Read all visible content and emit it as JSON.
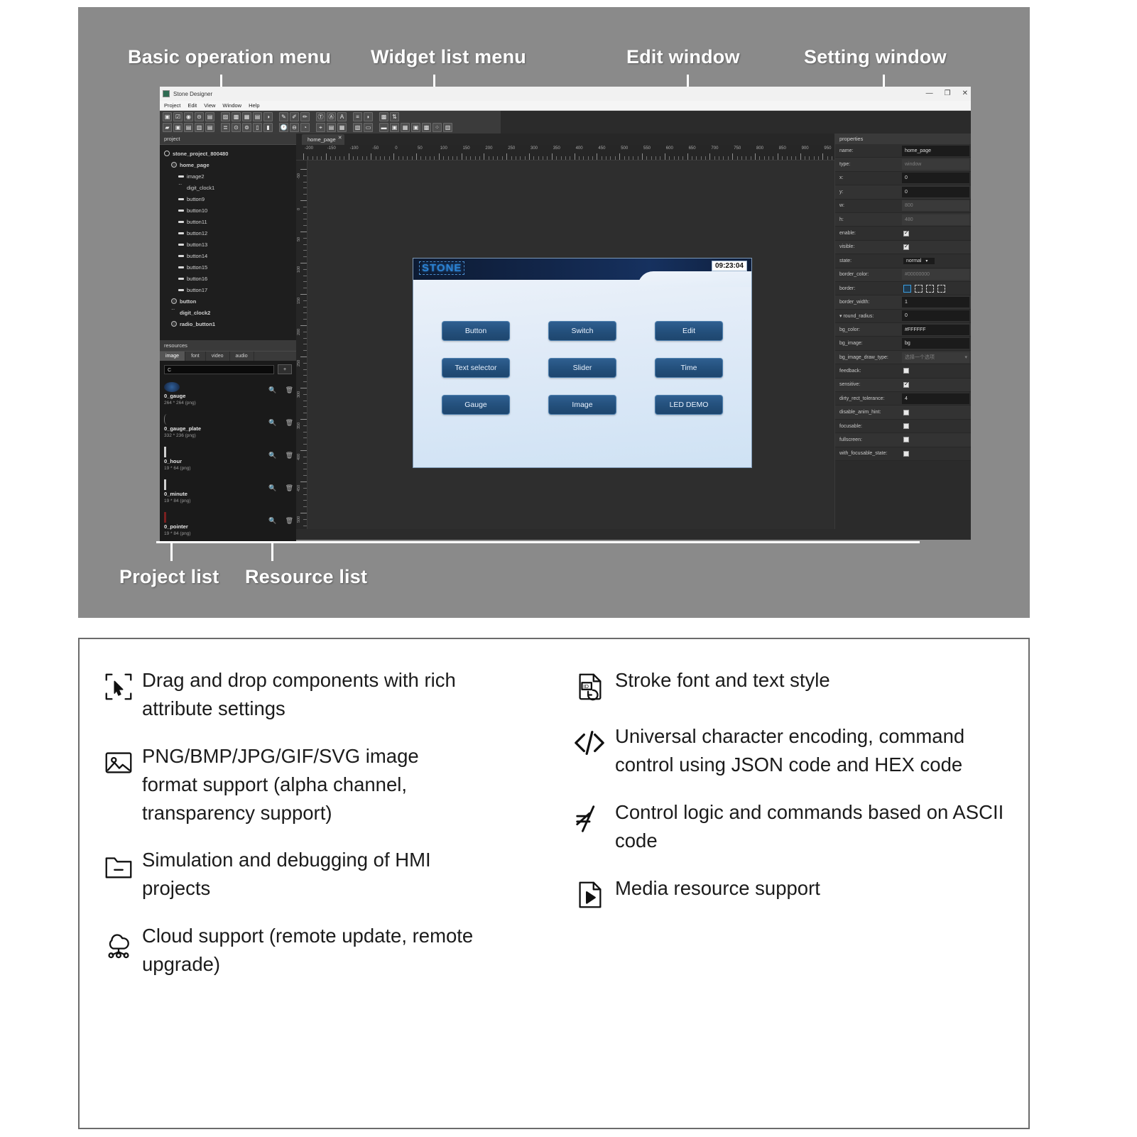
{
  "callouts": [
    {
      "id": "basic-operation-menu",
      "label": "Basic operation menu"
    },
    {
      "id": "widget-list-menu",
      "label": "Widget list menu"
    },
    {
      "id": "edit-window",
      "label": "Edit window"
    },
    {
      "id": "setting-window",
      "label": "Setting window"
    },
    {
      "id": "project-list",
      "label": "Project list"
    },
    {
      "id": "resource-list",
      "label": "Resource list"
    }
  ],
  "app": {
    "title": "Stone Designer",
    "window_buttons": {
      "minimize": "—",
      "maximize": "❐",
      "close": "✕"
    },
    "menu": [
      "Project",
      "Edit",
      "View",
      "Window",
      "Help"
    ],
    "toolbar": {
      "row1": [
        "frame-icon",
        "checkbox-icon",
        "radio-icon",
        "switch-icon",
        "save-icon",
        "image-icon",
        "image-anim-icon",
        "image-value-icon",
        "image-list-icon",
        "color-icon",
        "edit-icon",
        "edit-pen-icon",
        "edit-box-icon",
        "text-icon",
        "text-center-icon",
        "text-style-icon",
        "list-icon",
        "progress-icon",
        "grid-small-icon",
        "sliders-icon"
      ],
      "row2": [
        "gradient-icon",
        "view-icon",
        "panel-icon",
        "list-view-icon",
        "list-items-icon",
        "list-rows-icon",
        "slider-icon",
        "slider-alt-icon",
        "scrollbar-v-icon",
        "scrollbar-bar-icon",
        "clock-icon",
        "digit-clock-icon",
        "gauge-icon",
        "gauge-pointer-icon",
        "table-icon",
        "grid-icon",
        "grid-split-icon",
        "window-icon",
        "window-bar-icon",
        "window-full-icon",
        "table2-icon",
        "frame2-icon",
        "image2-icon",
        "dots-icon",
        "bars-icon"
      ]
    },
    "project_panel": {
      "title": "project",
      "tree": [
        {
          "label": "stone_project_800480",
          "icon": "project-icon",
          "indent": 0
        },
        {
          "label": "home_page",
          "icon": "page-icon",
          "indent": 1
        },
        {
          "label": "image2",
          "icon": "widget-icon",
          "indent": 2
        },
        {
          "label": "digit_clock1",
          "icon": "clock-icon",
          "indent": 2
        },
        {
          "label": "button9",
          "icon": "widget-icon",
          "indent": 2
        },
        {
          "label": "button10",
          "icon": "widget-icon",
          "indent": 2
        },
        {
          "label": "button11",
          "icon": "widget-icon",
          "indent": 2
        },
        {
          "label": "button12",
          "icon": "widget-icon",
          "indent": 2
        },
        {
          "label": "button13",
          "icon": "widget-icon",
          "indent": 2
        },
        {
          "label": "button14",
          "icon": "widget-icon",
          "indent": 2
        },
        {
          "label": "button15",
          "icon": "widget-icon",
          "indent": 2
        },
        {
          "label": "button16",
          "icon": "widget-icon",
          "indent": 2
        },
        {
          "label": "button17",
          "icon": "widget-icon",
          "indent": 2
        },
        {
          "label": "button",
          "icon": "page-icon",
          "indent": 1
        },
        {
          "label": "digit_clock2",
          "icon": "clock-icon",
          "indent": 1
        },
        {
          "label": "radio_button1",
          "icon": "radio-icon",
          "indent": 1
        }
      ]
    },
    "resource_panel": {
      "title": "resources",
      "tabs": [
        "image",
        "font",
        "video",
        "audio"
      ],
      "active_tab": "image",
      "search_value": "C",
      "add_button": "+",
      "items": [
        {
          "name": "0_gauge",
          "meta": "264 * 264 (png)"
        },
        {
          "name": "0_gauge_plate",
          "meta": "332 * 236 (png)"
        },
        {
          "name": "0_hour",
          "meta": "19 * 64 (png)"
        },
        {
          "name": "0_minute",
          "meta": "19 * 84 (png)"
        },
        {
          "name": "0_pointer",
          "meta": "19 * 84 (png)"
        }
      ],
      "item_actions": [
        "preview-icon",
        "delete-icon"
      ]
    },
    "edit_window": {
      "tab": "home_page",
      "tab_close": "✕",
      "ruler_labels": [
        "-200",
        "-150",
        "-100",
        "-50",
        "0",
        "50",
        "100",
        "150",
        "200",
        "250",
        "300",
        "350",
        "400",
        "450",
        "500",
        "550",
        "600",
        "650",
        "700",
        "750",
        "800",
        "850",
        "900",
        "950"
      ],
      "ruler_v_labels": [
        "-50",
        "0",
        "50",
        "100",
        "150",
        "200",
        "250",
        "300",
        "350",
        "400",
        "450",
        "500"
      ]
    },
    "hmi": {
      "logo": "STONE",
      "clock": "09:23:04",
      "buttons": [
        "Button",
        "Switch",
        "Edit",
        "Text selector",
        "Slider",
        "Time",
        "Gauge",
        "Image",
        "LED DEMO"
      ]
    },
    "properties_panel": {
      "title": "properties",
      "rows": [
        {
          "key": "name:",
          "value": "home_page",
          "type": "input"
        },
        {
          "key": "type:",
          "value": "window",
          "type": "disabled"
        },
        {
          "key": "x:",
          "value": "0",
          "type": "input"
        },
        {
          "key": "y:",
          "value": "0",
          "type": "input"
        },
        {
          "key": "w:",
          "value": "800",
          "type": "disabled"
        },
        {
          "key": "h:",
          "value": "480",
          "type": "disabled"
        },
        {
          "key": "enable:",
          "value": "",
          "type": "checkbox-on"
        },
        {
          "key": "visible:",
          "value": "",
          "type": "checkbox-on"
        },
        {
          "key": "state:",
          "value": "normal",
          "type": "select"
        },
        {
          "key": "border_color:",
          "value": "#00000000",
          "type": "disabled"
        },
        {
          "key": "border:",
          "value": "",
          "type": "border"
        },
        {
          "key": "border_width:",
          "value": "1",
          "type": "input"
        },
        {
          "key": "round_radius:",
          "value": "0",
          "type": "input-expand"
        },
        {
          "key": "bg_color:",
          "value": "#FFFFFF",
          "type": "input"
        },
        {
          "key": "bg_image:",
          "value": "bg",
          "type": "input"
        },
        {
          "key": "bg_image_draw_type:",
          "value": "选择一个选项",
          "type": "select-disabled"
        },
        {
          "key": "feedback:",
          "value": "",
          "type": "checkbox-off"
        },
        {
          "key": "sensitive:",
          "value": "",
          "type": "checkbox-on"
        },
        {
          "key": "dirty_rect_tolerance:",
          "value": "4",
          "type": "input"
        },
        {
          "key": "disable_anim_hint:",
          "value": "",
          "type": "checkbox-off"
        },
        {
          "key": "focusable:",
          "value": "",
          "type": "checkbox-off"
        },
        {
          "key": "fullscreen:",
          "value": "",
          "type": "checkbox-off"
        },
        {
          "key": "with_focusable_state:",
          "value": "",
          "type": "checkbox-off"
        }
      ]
    }
  },
  "features": {
    "left": [
      {
        "icon": "drag-drop-icon",
        "text": "Drag and drop components with rich attribute settings"
      },
      {
        "icon": "image-format-icon",
        "text": "PNG/BMP/JPG/GIF/SVG image format support (alpha channel, transparency support)"
      },
      {
        "icon": "folder-debug-icon",
        "text": "Simulation and debugging of HMI projects"
      },
      {
        "icon": "cloud-icon",
        "text": "Cloud support (remote update, remote upgrade)"
      }
    ],
    "right": [
      {
        "icon": "font-style-icon",
        "text": "Stroke font and text style"
      },
      {
        "icon": "code-icon",
        "text": "Universal character encoding, command control using JSON code and HEX code"
      },
      {
        "icon": "ascii-icon",
        "text": "Control logic and commands based on ASCII code"
      },
      {
        "icon": "media-play-icon",
        "text": "Media resource support"
      }
    ]
  },
  "colors": {
    "panel_gray": "#8a8a8a",
    "app_dark": "#2b2b2b",
    "hmi_blue": "#1e466e",
    "accent": "#3c9ee0"
  }
}
